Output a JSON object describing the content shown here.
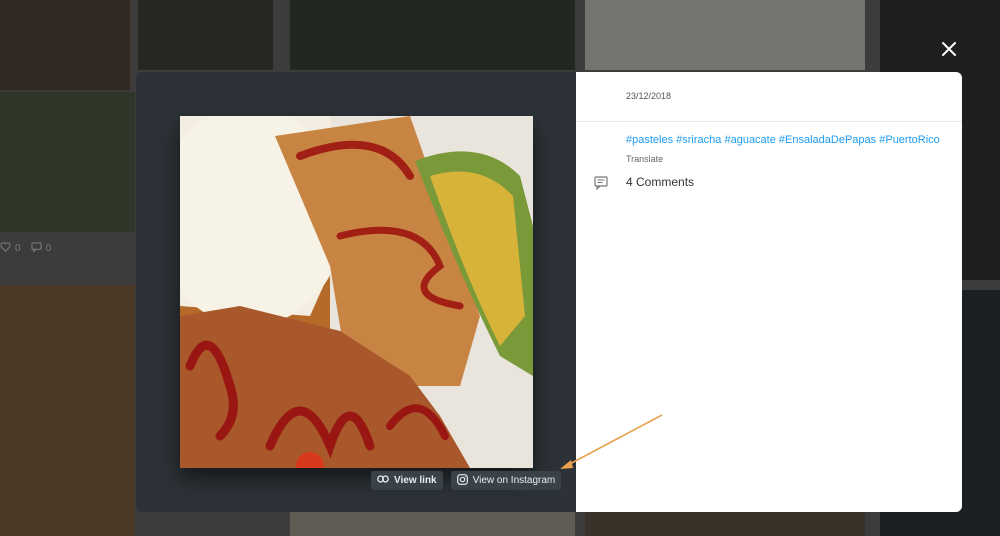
{
  "background_feed": {
    "tile1_likes": "0",
    "tile1_comments": "0"
  },
  "modal": {
    "close_icon": "close-icon",
    "media": {
      "view_link_label": "View link",
      "view_instagram_label": "View on Instagram",
      "link_icon": "link-icon",
      "instagram_icon": "instagram-icon"
    },
    "post": {
      "date": "23/12/2018",
      "hashtags": [
        "#pasteles",
        "#sriracha",
        "#aguacate",
        "#EnsaladaDePapas",
        "#PuertoRico"
      ],
      "translate_label": "Translate",
      "comments_label": "4 Comments",
      "comment_icon": "comment-icon"
    }
  },
  "colors": {
    "accent": "#1e9bf0",
    "media_bg": "#2c3237",
    "annotation_arrow": "#e8a24f"
  }
}
